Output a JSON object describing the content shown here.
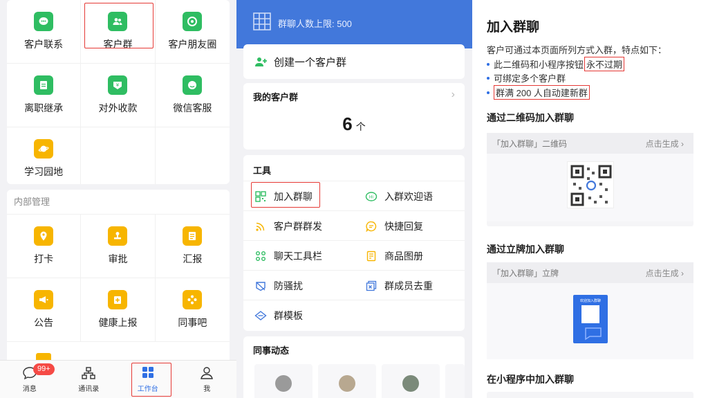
{
  "workbench": {
    "apps_top": [
      {
        "label": "客户联系",
        "icon": "chat-bubble-icon",
        "color": "green"
      },
      {
        "label": "客户群",
        "icon": "group-icon",
        "color": "green",
        "highlighted": true
      },
      {
        "label": "客户朋友圈",
        "icon": "moments-icon",
        "color": "green"
      },
      {
        "label": "离职继承",
        "icon": "document-icon",
        "color": "green"
      },
      {
        "label": "对外收款",
        "icon": "yuan-icon",
        "color": "green"
      },
      {
        "label": "微信客服",
        "icon": "wechat-service-icon",
        "color": "green"
      },
      {
        "label": "学习园地",
        "icon": "planet-icon",
        "color": "yellow"
      }
    ],
    "internal_title": "内部管理",
    "apps_internal": [
      {
        "label": "打卡",
        "icon": "location-icon"
      },
      {
        "label": "审批",
        "icon": "stamp-icon"
      },
      {
        "label": "汇报",
        "icon": "report-icon"
      },
      {
        "label": "公告",
        "icon": "megaphone-icon"
      },
      {
        "label": "健康上报",
        "icon": "health-icon"
      },
      {
        "label": "同事吧",
        "icon": "community-icon"
      }
    ],
    "tabbar": [
      {
        "label": "消息",
        "icon": "message-icon",
        "badge": "99+"
      },
      {
        "label": "通讯录",
        "icon": "contacts-icon"
      },
      {
        "label": "工作台",
        "icon": "workbench-icon",
        "active": true
      },
      {
        "label": "我",
        "icon": "profile-icon"
      }
    ]
  },
  "customer_group": {
    "header_text": "群聊人数上限: 500",
    "create_label": "创建一个客户群",
    "my_groups_title": "我的客户群",
    "my_groups_count": "6",
    "my_groups_unit": "个",
    "tools_title": "工具",
    "tools": [
      {
        "label": "加入群聊",
        "icon": "qrcode-icon",
        "highlighted": true
      },
      {
        "label": "入群欢迎语",
        "icon": "welcome-chat-icon"
      },
      {
        "label": "客户群群发",
        "icon": "broadcast-icon"
      },
      {
        "label": "快捷回复",
        "icon": "quick-reply-icon"
      },
      {
        "label": "聊天工具栏",
        "icon": "toolbar-icon"
      },
      {
        "label": "商品图册",
        "icon": "catalog-icon"
      },
      {
        "label": "防骚扰",
        "icon": "shield-icon"
      },
      {
        "label": "群成员去重",
        "icon": "dedupe-icon"
      },
      {
        "label": "群模板",
        "icon": "template-icon"
      }
    ],
    "feed_title": "同事动态"
  },
  "join_group": {
    "title": "加入群聊",
    "description": "客户可通过本页面所列方式入群，特点如下：",
    "bullets": [
      {
        "text": "此二维码和小程序按钮",
        "highlight": "永不过期"
      },
      {
        "text": "可绑定多个客户群",
        "highlight": ""
      },
      {
        "text": "",
        "highlight": "群满 200 人自动建新群"
      }
    ],
    "sections": [
      {
        "title": "通过二维码加入群聊",
        "box_label": "「加入群聊」二维码",
        "action": "点击生成 ›"
      },
      {
        "title": "通过立牌加入群聊",
        "box_label": "「加入群聊」立牌",
        "action": "点击生成 ›",
        "stand_title": "欢迎加入群聊"
      },
      {
        "title": "在小程序中加入群聊"
      }
    ]
  },
  "colors": {
    "accent_blue": "#4278db",
    "green": "#2fbd62",
    "yellow": "#f7b500",
    "highlight_red": "#e53935"
  }
}
